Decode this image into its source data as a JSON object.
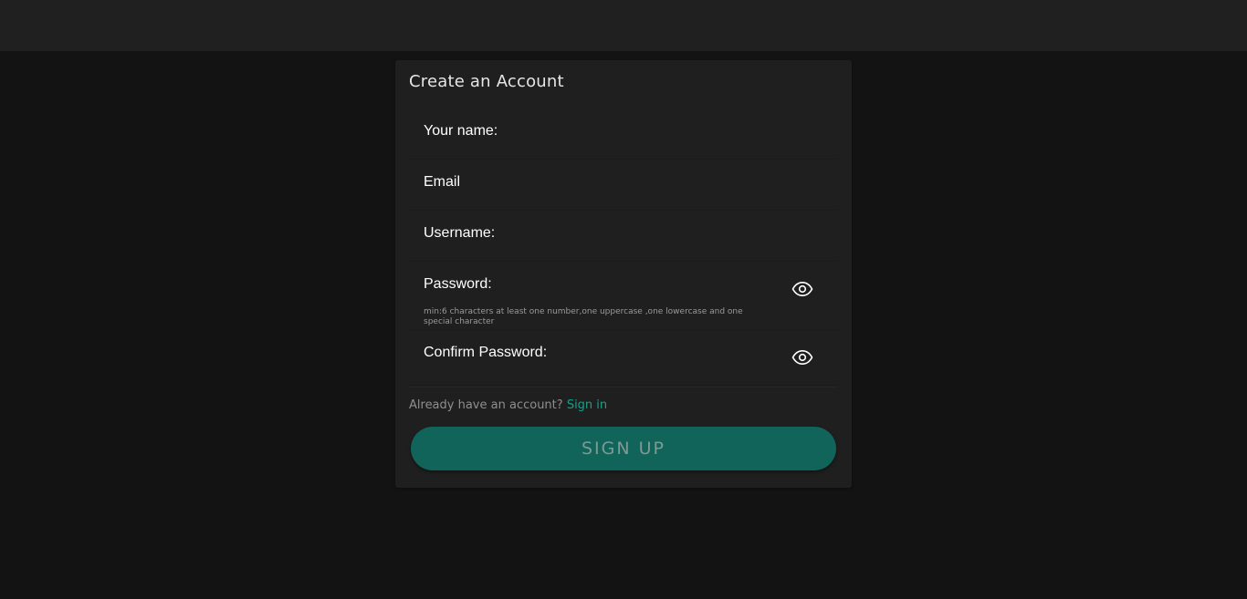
{
  "form": {
    "title": "Create an Account",
    "fields": {
      "name": {
        "label": "Your name:",
        "value": ""
      },
      "email": {
        "label": "Email",
        "value": ""
      },
      "username": {
        "label": "Username:",
        "value": ""
      },
      "password": {
        "label": "Password:",
        "value": "",
        "hint": "min:6 characters at least one number,one uppercase ,one lowercase and one special character",
        "toggle_icon": "eye-icon"
      },
      "confirm_password": {
        "label": "Confirm Password:",
        "value": "",
        "toggle_icon": "eye-icon"
      }
    },
    "signin_prompt": "Already have an account?",
    "signin_link": "Sign in",
    "submit_label": "SIGN UP"
  },
  "colors": {
    "background": "#131313",
    "topbar": "#202020",
    "card": "#1f1f1f",
    "accent": "#12a38a",
    "button": "#10645a",
    "button_text": "#7f9a95"
  }
}
